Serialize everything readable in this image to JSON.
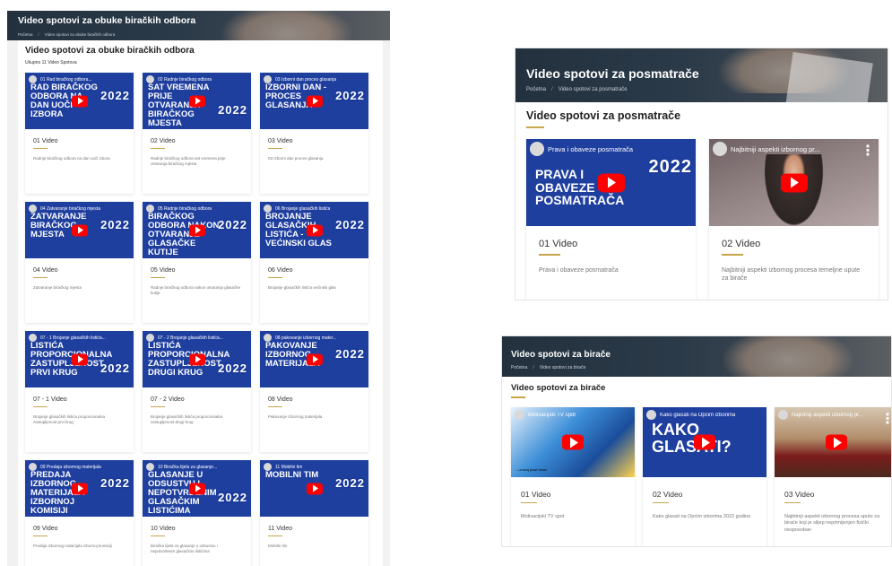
{
  "colors": {
    "accent": "#c7a54a",
    "thumb_blue": "#1f3f9f",
    "play_red": "#ff0000",
    "banner_dark": "#23313f"
  },
  "icons": {
    "play": "play-button-icon",
    "more": "more-vertical-icon",
    "avatar": "channel-avatar-icon"
  },
  "left": {
    "banner_title": "Video spotovi za obuke biračkih odbora",
    "crumbs": [
      "Početna",
      "Video spotovi za obuke biračkih odbora"
    ],
    "title": "Video spotovi za obuke biračkih odbora",
    "subtitle": "Ukupno 11 Video Spotova",
    "cards": [
      {
        "thumb_title": "01 Rad biračkog odbora...",
        "thumb_text": "RAD BIRAČKOG ODBORA NA DAN UOČI IZBORA",
        "badge": "2022",
        "num": "01 Video",
        "desc": "Radnje biračkog odbora na dan uoči izbora"
      },
      {
        "thumb_title": "02 Radnje biračkog odbora",
        "thumb_text": "SAT VREMENA PRIJE OTVARANJA BIRAČKOG MJESTA",
        "badge": "2022",
        "num": "02 Video",
        "desc": "Radnje biračkog odbora sat vremena prije otvaranja biračkog mjesta"
      },
      {
        "thumb_title": "03 Izborni dan proces glasanja",
        "thumb_text": "IZBORNI DAN - PROCES GLASANJA",
        "badge": "2022",
        "num": "03 Video",
        "desc": "03 Izborni dan proces glasanja"
      },
      {
        "thumb_title": "04 Zatvaranje biračkog mjesta",
        "thumb_text": "ZATVARANJE BIRAČKOG MJESTA",
        "badge": "2022",
        "num": "04 Video",
        "desc": "Zatvaranje biračkog mjesta"
      },
      {
        "thumb_title": "05 Radnje biračkog odbora",
        "thumb_text": "BIRAČKOG ODBORA NAKON OTVARANJE GLASAČKE KUTIJE",
        "badge": "2022",
        "num": "05 Video",
        "desc": "Radnje biračkog odbora nakon otvaranja glasačke kutije"
      },
      {
        "thumb_title": "06 Brojanje glasačkih listića",
        "thumb_text": "BROJANJE GLASAČKIH LISTIĆA - VEĆINSKI GLAS",
        "badge": "2022",
        "num": "06 Video",
        "desc": "Brojanje glasačkih listića većinski glas"
      },
      {
        "thumb_title": "07 - 1 Brojanje glasačkih listića...",
        "thumb_text": "LISTIĆA PROPORCIONALNA ZASTUPLJENOST PRVI KRUG",
        "badge": "2022",
        "num": "07 - 1 Video",
        "desc": "Brojanje glasačkih listića proporcionalna zastupljenost prvi krug"
      },
      {
        "thumb_title": "07 - 2 Brojanje glasačkih listića...",
        "thumb_text": "LISTIĆA PROPORCIONALNA ZASTUPLJENOST DRUGI KRUG",
        "badge": "2022",
        "num": "07 - 2 Video",
        "desc": "Brojanje glasačkih listića proporcionalna zastupljenost drugi krug"
      },
      {
        "thumb_title": "08 pakovanje izbornog mater...",
        "thumb_text": "PAKOVANJE IZBORNOG MATERIJALA",
        "badge": "2022",
        "num": "08 Video",
        "desc": "Pakovanje izbornog materijala"
      },
      {
        "thumb_title": "09 Predaja izbornog materijala",
        "thumb_text": "PREDAJA IZBORNOG MATERIJALA IZBORNOJ KOMISIJI",
        "badge": "2022",
        "num": "09 Video",
        "desc": "Predaja izbornog materijala izbornoj komisiji"
      },
      {
        "thumb_title": "10 Biračka tijela za glasanje...",
        "thumb_text": "GLASANJE U ODSUSTVU I NEPOTVRĐENIM GLASAČKIM LISTIĆIMA",
        "badge": "2022",
        "num": "10 Video",
        "desc": "Biračka tijela za glasanje u odsustvu i nepotvrđenim glasačkim listićima"
      },
      {
        "thumb_title": "11 Mobilni tim",
        "thumb_text": "MOBILNI TIM",
        "badge": "2022",
        "num": "11 Video",
        "desc": "Mobilni tim"
      }
    ]
  },
  "right_top": {
    "banner_title": "Video spotovi za posmatrače",
    "crumbs": [
      "Početna",
      "Video spotovi za posmatrače"
    ],
    "title": "Video spotovi za posmatrače",
    "cards": [
      {
        "thumb_title": "Prava i obaveze posmatrača",
        "thumb_text": "PRAVA I OBAVEZE POSMATRAČA",
        "badge": "2022",
        "num": "01 Video",
        "desc": "Prava i obaveze posmatrača"
      },
      {
        "thumb_title": "Najbitniji aspekti izbornog pr...",
        "num": "02 Video",
        "desc": "Najbitniji aspekti izbornog procesa temeljne upute za birače"
      }
    ]
  },
  "right_bottom": {
    "banner_title": "Video spotovi za birače",
    "crumbs": [
      "Početna",
      "Video spotovi za birače"
    ],
    "title": "Video spotovi za birače",
    "cards": [
      {
        "thumb_title": "Motivacijski TV spot",
        "caption": "...a svoj pravi izbor!",
        "num": "01 Video",
        "desc": "Motivacijski TV spot"
      },
      {
        "thumb_title": "Kako glasati na Općim izborima",
        "thumb_text": "KAKO GLASATI?",
        "num": "02 Video",
        "desc": "Kako glasati na Općim izborima 2022 godine"
      },
      {
        "thumb_title": "Najbitniji aspekti izbornog pr...",
        "num": "03 Video",
        "desc": "Najbitniji aspekti izbornog procesa upute za birače koji je slijep neprimijenjen fizički nesposoban"
      }
    ]
  }
}
